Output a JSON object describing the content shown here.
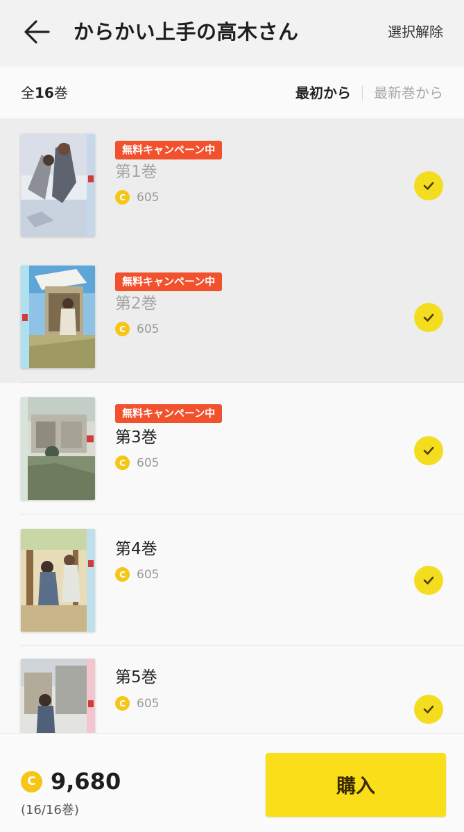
{
  "header": {
    "title": "からかい上手の高木さん",
    "deselect_label": "選択解除",
    "back_icon": "arrow-left-icon"
  },
  "subbar": {
    "total_prefix": "全",
    "total_count": "16",
    "total_suffix": "巻",
    "sort_first": "最初から",
    "sort_latest": "最新巻から"
  },
  "volumes": [
    {
      "badge": "無料キャンペーン中",
      "label": "第1巻",
      "price": "605",
      "selected": true
    },
    {
      "badge": "無料キャンペーン中",
      "label": "第2巻",
      "price": "605",
      "selected": true
    },
    {
      "badge": "無料キャンペーン中",
      "label": "第3巻",
      "price": "605",
      "selected": true
    },
    {
      "badge": "",
      "label": "第4巻",
      "price": "605",
      "selected": true
    },
    {
      "badge": "",
      "label": "第5巻",
      "price": "605",
      "selected": true
    }
  ],
  "coin_symbol": "C",
  "footer": {
    "total_price": "9,680",
    "selection_count": "(16/16巻)",
    "buy_label": "購入"
  },
  "colors": {
    "accent_yellow": "#fbde1a",
    "badge_red": "#f2512d",
    "coin": "#f5c518"
  }
}
